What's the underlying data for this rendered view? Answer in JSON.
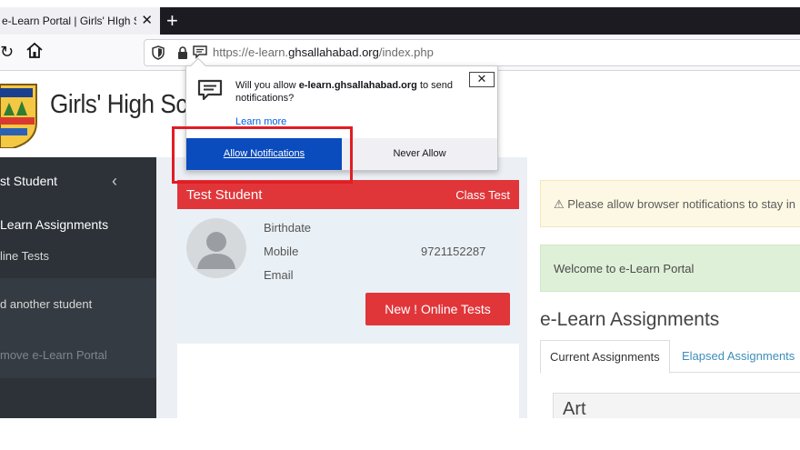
{
  "browser": {
    "tab_title": "e-Learn Portal | Girls' HIgh Scho",
    "tab_close": "✕",
    "new_tab": "+",
    "url_prefix": "https://e-learn.",
    "url_domain": "ghsallahabad.org",
    "url_suffix": "/index.php"
  },
  "notification_prompt": {
    "message_pre": "Will you allow ",
    "message_domain": "e-learn.ghsallahabad.org",
    "message_post": " to send notifications?",
    "learn_more": "Learn more",
    "close": "✕",
    "allow_label": "Allow Notifications",
    "never_label": "Never Allow",
    "highlight_color": "#e11d24"
  },
  "site": {
    "title": "Girls' High Sch"
  },
  "sidebar": {
    "user": "st Student",
    "collapse": "‹",
    "items": [
      {
        "label": "Learn Assignments"
      },
      {
        "label": "line Tests"
      },
      {
        "label": "d another student"
      },
      {
        "label": "move e-Learn Portal"
      }
    ]
  },
  "student_card": {
    "name": "Test Student",
    "badge": "Class Test",
    "labels": [
      "Birthdate",
      "Mobile",
      "Email"
    ],
    "mobile": "9721152287",
    "button": "New ! Online Tests",
    "accent": "#e0363a"
  },
  "main": {
    "warning": "Please allow browser notifications to stay in",
    "welcome": "Welcome to e-Learn Portal",
    "assignments_title": "e-Learn Assignments",
    "tabs": [
      {
        "label": "Current Assignments"
      },
      {
        "label": "Elapsed Assignments"
      }
    ],
    "subject": "Art"
  }
}
